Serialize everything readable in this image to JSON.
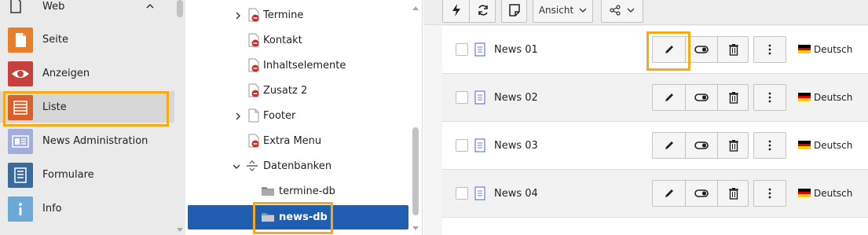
{
  "module_menu": {
    "group": {
      "label": "Web",
      "icon": "file-icon"
    },
    "items": [
      {
        "label": "Seite",
        "icon": "page-icon",
        "color": "#e87e2a"
      },
      {
        "label": "Anzeigen",
        "icon": "eye-icon",
        "color": "#c8403c"
      },
      {
        "label": "Liste",
        "icon": "list-icon",
        "color": "#d8602a",
        "active": true
      },
      {
        "label": "News Administration",
        "icon": "news-icon",
        "color": "#a2aede"
      },
      {
        "label": "Formulare",
        "icon": "form-icon",
        "color": "#3a6b9c"
      },
      {
        "label": "Info",
        "icon": "info-icon",
        "color": "#6baad6"
      }
    ]
  },
  "page_tree": {
    "nodes": [
      {
        "label": "Termine",
        "icon": "page-restricted-icon",
        "toggle": "collapsed"
      },
      {
        "label": "Kontakt",
        "icon": "page-restricted-icon"
      },
      {
        "label": "Inhaltselemente",
        "icon": "page-restricted-icon"
      },
      {
        "label": "Zusatz 2",
        "icon": "page-restricted-icon"
      },
      {
        "label": "Footer",
        "icon": "page-icon",
        "toggle": "collapsed"
      },
      {
        "label": "Extra Menu",
        "icon": "page-restricted-icon"
      },
      {
        "label": "Datenbanken",
        "icon": "separator-icon",
        "toggle": "expanded"
      },
      {
        "label": "termine-db",
        "icon": "folder-icon"
      },
      {
        "label": "news-db",
        "icon": "folder-icon",
        "selected": true
      }
    ]
  },
  "toolbar": {
    "view_label": "Ansicht",
    "buttons": [
      "lightning-icon",
      "refresh-icon",
      "note-icon",
      "share-icon"
    ]
  },
  "records": [
    {
      "title": "News 01",
      "language": "Deutsch"
    },
    {
      "title": "News 02",
      "language": "Deutsch"
    },
    {
      "title": "News 03",
      "language": "Deutsch"
    },
    {
      "title": "News 04",
      "language": "Deutsch"
    }
  ],
  "colors": {
    "highlight": "#f9aa12",
    "selected_node": "#1f5eb1",
    "restricted_badge": "#c8302c"
  }
}
